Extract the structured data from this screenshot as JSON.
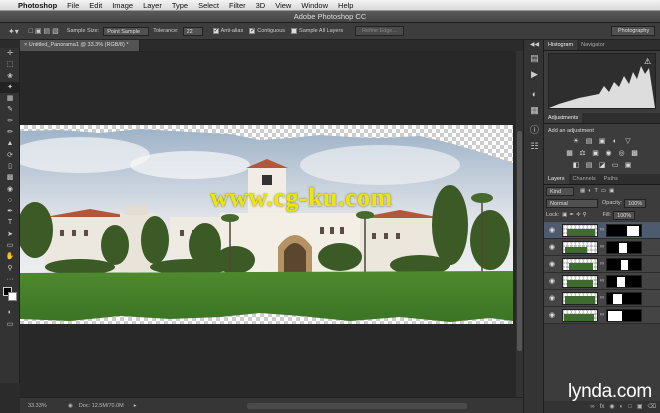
{
  "menubar": {
    "apple": "",
    "app": "Photoshop",
    "items": [
      "File",
      "Edit",
      "Image",
      "Layer",
      "Type",
      "Select",
      "Filter",
      "3D",
      "View",
      "Window",
      "Help"
    ]
  },
  "titlebar": {
    "title": "Adobe Photoshop CC"
  },
  "options": {
    "sample_size_label": "Sample Size:",
    "sample_size_value": "Point Sample",
    "tolerance_label": "Tolerance:",
    "tolerance_value": "22",
    "antialias": "Anti-alias",
    "contiguous": "Contiguous",
    "sample_all": "Sample All Layers",
    "refine": "Refine Edge...",
    "workspace": "Photography"
  },
  "document": {
    "tab": "× Untitled_Panorama1 @ 33.3% (RGB/8) *"
  },
  "status": {
    "zoom": "33.33%",
    "doc": "Doc: 12.5M/70.0M"
  },
  "panels": {
    "histogram_tab": "Histogram",
    "navigator_tab": "Navigator",
    "adjustments_tab": "Adjustments",
    "add_adjustment": "Add an adjustment",
    "layers_tab": "Layers",
    "channels_tab": "Channels",
    "paths_tab": "Paths",
    "kind": "Kind",
    "blend": "Normal",
    "opacity_label": "Opacity:",
    "opacity_value": "100%",
    "lock_label": "Lock:",
    "fill_label": "Fill:",
    "fill_value": "100%"
  },
  "watermark": "www.cg-ku.com",
  "brand": "lynda.com",
  "colors": {
    "accent": "#4e5a6e",
    "watermark": "#f0e600"
  }
}
